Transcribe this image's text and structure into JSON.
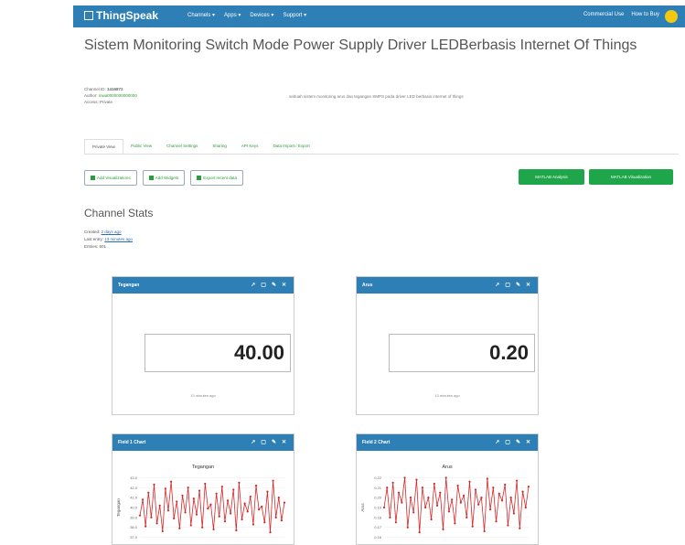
{
  "nav": {
    "logo": "ThingSpeak",
    "items": [
      "Channels",
      "Apps",
      "Devices",
      "Support"
    ],
    "right": [
      "Commercial Use",
      "How to Buy"
    ]
  },
  "page": {
    "title": "Sistem Monitoring Switch Mode Power Supply Driver LEDBerbasis Internet Of Things",
    "channel_id_label": "Channel ID:",
    "channel_id": "1416872",
    "author_label": "Author:",
    "author": "mwa0000000000000",
    "access": "Access: Private",
    "description": "sebuah sistem monitoring arus dan tegangan SMPS pada driver LED berbasis internet of things"
  },
  "tabs": [
    "Private View",
    "Public View",
    "Channel Settings",
    "Sharing",
    "API Keys",
    "Data Import / Export"
  ],
  "buttons": {
    "add_viz": "Add Visualizations",
    "add_widgets": "Add Widgets",
    "export": "Export recent data",
    "matlab_analysis": "MATLAB Analysis",
    "matlab_viz": "MATLAB Visualization"
  },
  "stats": {
    "title": "Channel Stats",
    "created_label": "Created:",
    "created": "2 days ago",
    "last_entry_label": "Last entry:",
    "last_entry": "13 minutes ago",
    "entries": "Entries: 501"
  },
  "widgets": {
    "w1": {
      "title": "Tegangan",
      "value": "40.00",
      "ago": "13 minutes ago"
    },
    "w2": {
      "title": "Arus",
      "value": "0.20",
      "ago": "13 minutes ago"
    },
    "c1": {
      "title": "Field 1 Chart",
      "chart_title": "Tegangan"
    },
    "c2": {
      "title": "Field 2 Chart",
      "chart_title": "Arus"
    }
  },
  "colors": {
    "nav": "#2d7fb5",
    "accent": "#2a9d3a",
    "line": "#d62728"
  },
  "chart_data": [
    {
      "type": "line",
      "title": "Tegangan",
      "ylabel": "Tegangan",
      "yticks": [
        "37.0",
        "38.0",
        "39.0",
        "40.0",
        "41.0",
        "42.0",
        "43.0"
      ],
      "ylim": [
        36.5,
        43.5
      ],
      "values": [
        39.2,
        40.8,
        38.1,
        41.5,
        39.0,
        42.3,
        38.4,
        40.2,
        37.6,
        41.9,
        39.7,
        42.6,
        38.9,
        40.6,
        37.9,
        41.2,
        39.5,
        42.0,
        38.2,
        40.9,
        39.3,
        41.7,
        38.0,
        42.4,
        39.9,
        40.3,
        37.8,
        41.4,
        39.1,
        42.1,
        38.6,
        40.7,
        39.4,
        41.8,
        37.7,
        42.5,
        38.8,
        40.4,
        39.6,
        41.1,
        38.3,
        42.2,
        39.8,
        40.1,
        38.5,
        41.6,
        37.5,
        42.7,
        39.0,
        41.0,
        38.7,
        40.5
      ]
    },
    {
      "type": "line",
      "title": "Arus",
      "ylabel": "Arus",
      "yticks": [
        "0.16",
        "0.17",
        "0.18",
        "0.19",
        "0.20",
        "0.21",
        "0.22"
      ],
      "ylim": [
        0.155,
        0.225
      ],
      "values": [
        0.19,
        0.21,
        0.18,
        0.215,
        0.175,
        0.205,
        0.195,
        0.22,
        0.17,
        0.2,
        0.185,
        0.218,
        0.165,
        0.21,
        0.19,
        0.2,
        0.178,
        0.214,
        0.192,
        0.205,
        0.168,
        0.22,
        0.186,
        0.198,
        0.174,
        0.212,
        0.195,
        0.202,
        0.18,
        0.216,
        0.171,
        0.208,
        0.193,
        0.2,
        0.166,
        0.219,
        0.188,
        0.21,
        0.176,
        0.204,
        0.197,
        0.213,
        0.172,
        0.2,
        0.184,
        0.217,
        0.169,
        0.206,
        0.19,
        0.211
      ]
    }
  ]
}
